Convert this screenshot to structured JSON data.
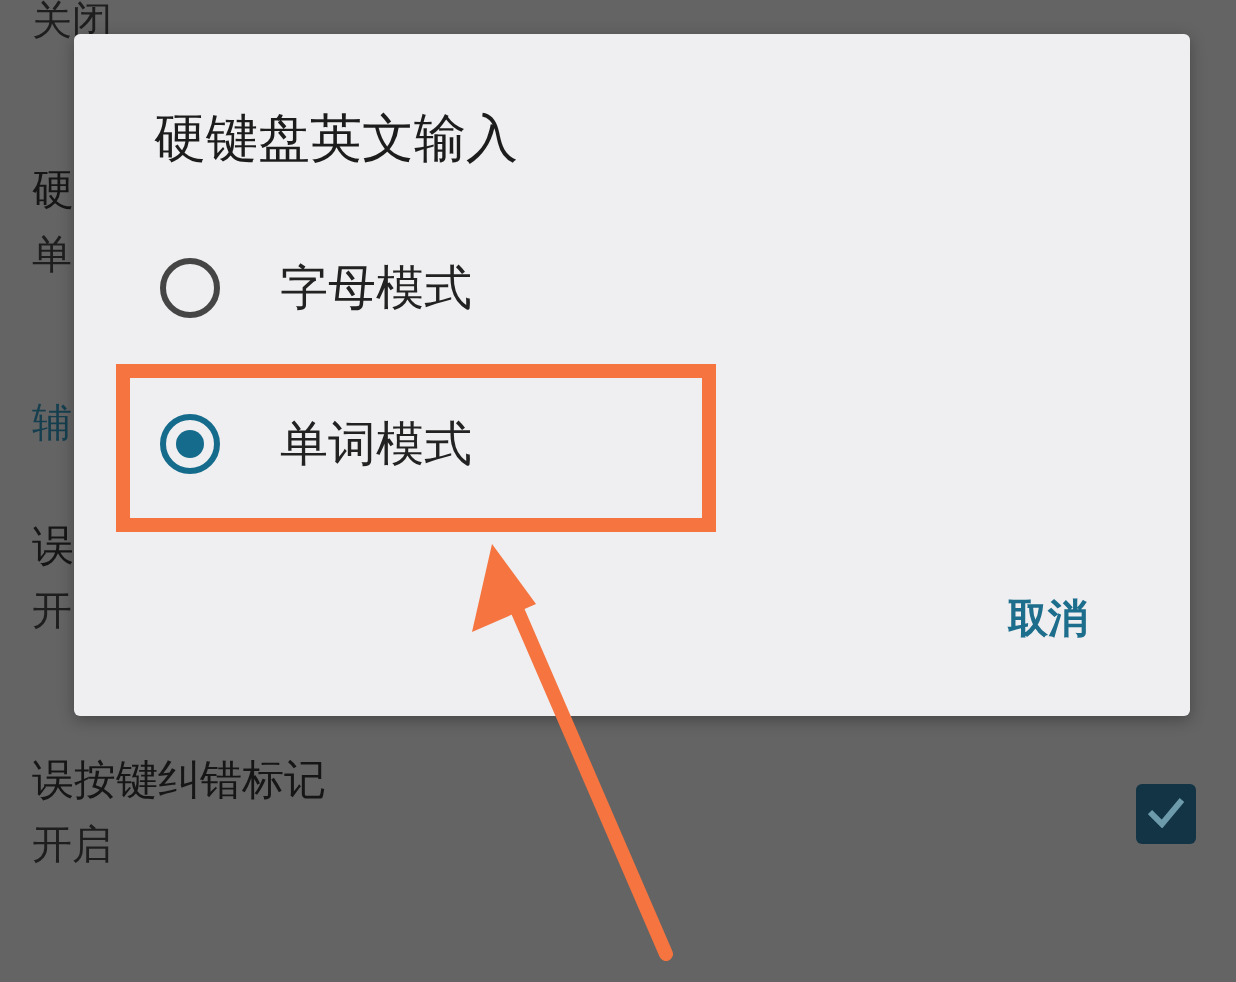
{
  "background_list": [
    {
      "kind": "setting",
      "subtitle": "关闭"
    },
    {
      "kind": "setting",
      "title": "硬",
      "subtitle": "单"
    },
    {
      "kind": "header",
      "title": "辅"
    },
    {
      "kind": "setting",
      "title": "误",
      "subtitle": "开"
    },
    {
      "kind": "setting",
      "title": "误按键纠错标记",
      "subtitle": "开启",
      "checked": true
    }
  ],
  "dialog": {
    "title": "硬键盘英文输入",
    "options": [
      {
        "label": "字母模式",
        "selected": false,
        "highlighted": false
      },
      {
        "label": "单词模式",
        "selected": true,
        "highlighted": true
      }
    ],
    "buttons": [
      "取消"
    ]
  }
}
